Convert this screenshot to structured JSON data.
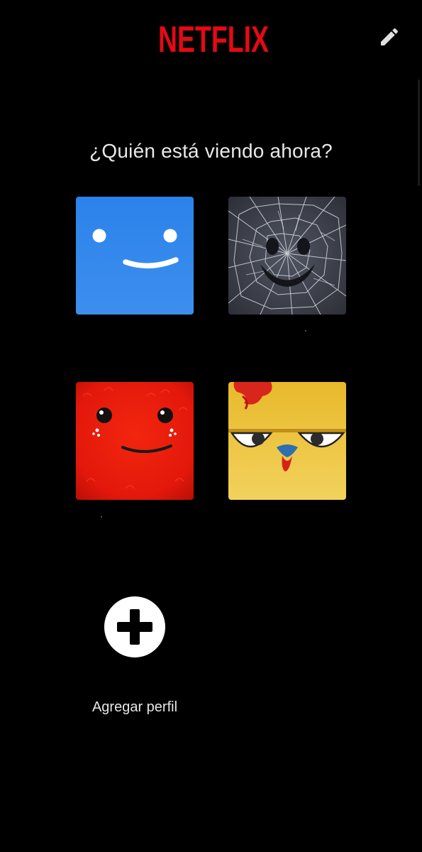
{
  "header": {
    "logo_text": "NETFLIX",
    "brand_color": "#E50914",
    "edit_icon": "pencil-icon"
  },
  "screen": {
    "title": "¿Quién está viendo ahora?"
  },
  "profiles": [
    {
      "name": "",
      "avatar": "blue-smiley-avatar",
      "color": "#2E86EC"
    },
    {
      "name": "",
      "avatar": "shattered-glass-smiley-avatar",
      "color": "#3A3D45"
    },
    {
      "name": "",
      "avatar": "red-fluffy-monster-avatar",
      "color": "#E0160B"
    },
    {
      "name": "",
      "avatar": "yellow-chicken-avatar",
      "color": "#EDC33A"
    }
  ],
  "add_profile": {
    "label": "Agregar perfil",
    "icon": "plus-icon"
  }
}
